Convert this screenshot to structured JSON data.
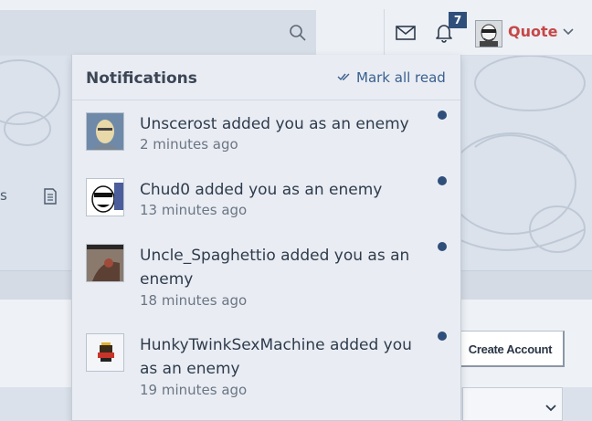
{
  "header": {
    "notification_count": "7",
    "user_name": "Quote"
  },
  "background": {
    "tab_fragment": "s",
    "create_account_label": "Create Account"
  },
  "notifications": {
    "title": "Notifications",
    "mark_all_read": "Mark all read",
    "items": [
      {
        "text": "Unscerost added you as an enemy",
        "time": "2 minutes ago",
        "unread": true
      },
      {
        "text": "Chud0 added you as an enemy",
        "time": "13 minutes ago",
        "unread": true
      },
      {
        "text": "Uncle_Spaghettio added you as an enemy",
        "time": "18 minutes ago",
        "unread": true
      },
      {
        "text": "HunkyTwinkSexMachine added you as an enemy",
        "time": "19 minutes ago",
        "unread": true
      }
    ]
  },
  "colors": {
    "accent": "#2f4f7a",
    "user_name": "#c64747",
    "link": "#3a5f8f"
  }
}
